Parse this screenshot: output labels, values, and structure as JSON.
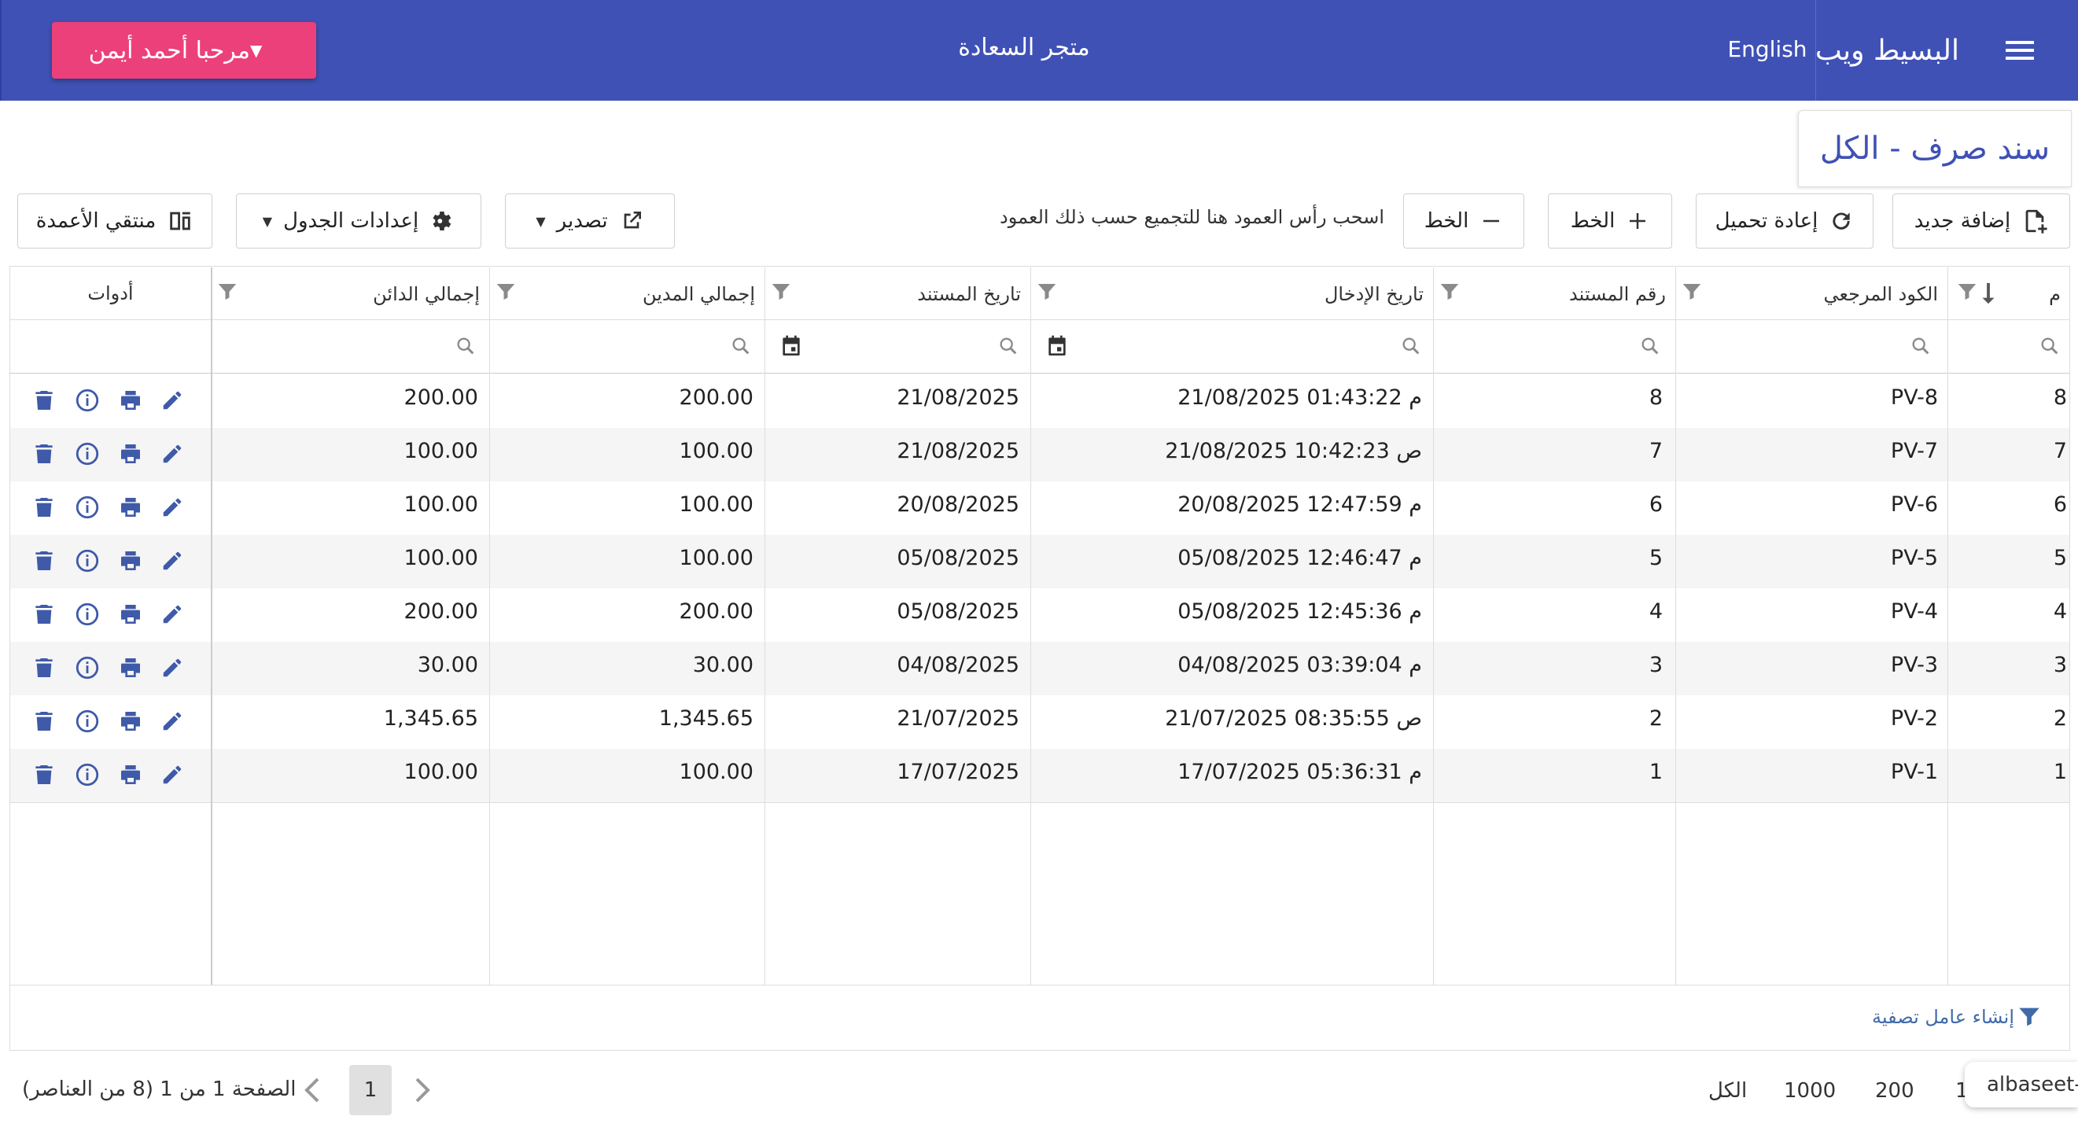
{
  "navbar": {
    "brand": "البسيط ويب",
    "language": "English",
    "store": "متجر السعادة",
    "user": "مرحبا أحمد أيمن"
  },
  "page": {
    "title": "سند صرف - الكل"
  },
  "toolbar": {
    "add_new": "إضافة جديد",
    "reload": "إعادة تحميل",
    "font_plus": "الخط",
    "font_minus": "الخط",
    "drag_hint": "اسحب رأس العمود هنا للتجميع حسب ذلك العمود",
    "export": "تصدير",
    "table_settings": "إعدادات الجدول",
    "column_chooser": "منتقي الأعمدة"
  },
  "columns": {
    "index": "م",
    "ref_code": "الكود المرجعي",
    "doc_no": "رقم المستند",
    "entry_date": "تاريخ الإدخال",
    "doc_date": "تاريخ المستند",
    "total_debit": "إجمالي المدين",
    "total_credit": "إجمالي الدائن",
    "tools": "أدوات"
  },
  "rows": [
    {
      "index": "8",
      "ref": "PV-8",
      "doc": "8",
      "entry": "21/08/2025 01:43:22 م",
      "date": "21/08/2025",
      "debit": "200.00",
      "credit": "200.00"
    },
    {
      "index": "7",
      "ref": "PV-7",
      "doc": "7",
      "entry": "21/08/2025 10:42:23 ص",
      "date": "21/08/2025",
      "debit": "100.00",
      "credit": "100.00"
    },
    {
      "index": "6",
      "ref": "PV-6",
      "doc": "6",
      "entry": "20/08/2025 12:47:59 م",
      "date": "20/08/2025",
      "debit": "100.00",
      "credit": "100.00"
    },
    {
      "index": "5",
      "ref": "PV-5",
      "doc": "5",
      "entry": "05/08/2025 12:46:47 م",
      "date": "05/08/2025",
      "debit": "100.00",
      "credit": "100.00"
    },
    {
      "index": "4",
      "ref": "PV-4",
      "doc": "4",
      "entry": "05/08/2025 12:45:36 م",
      "date": "05/08/2025",
      "debit": "200.00",
      "credit": "200.00"
    },
    {
      "index": "3",
      "ref": "PV-3",
      "doc": "3",
      "entry": "04/08/2025 03:39:04 م",
      "date": "04/08/2025",
      "debit": "30.00",
      "credit": "30.00"
    },
    {
      "index": "2",
      "ref": "PV-2",
      "doc": "2",
      "entry": "21/07/2025 08:35:55 ص",
      "date": "21/07/2025",
      "debit": "1,345.65",
      "credit": "1,345.65"
    },
    {
      "index": "1",
      "ref": "PV-1",
      "doc": "1",
      "entry": "17/07/2025 05:36:31 م",
      "date": "17/07/2025",
      "debit": "100.00",
      "credit": "100.00"
    }
  ],
  "filter_builder": "إنشاء عامل تصفية",
  "pager": {
    "current_page": "1",
    "info": "الصفحة 1 من 1 (8 من العناصر)",
    "size_all": "الكل",
    "size_1000": "1000",
    "size_200": "200",
    "size_partial": "1"
  },
  "watermark": "albaseet-",
  "colors": {
    "primary": "#3f51b5",
    "accent": "#ec407a",
    "icon": "#3f5aa8"
  }
}
